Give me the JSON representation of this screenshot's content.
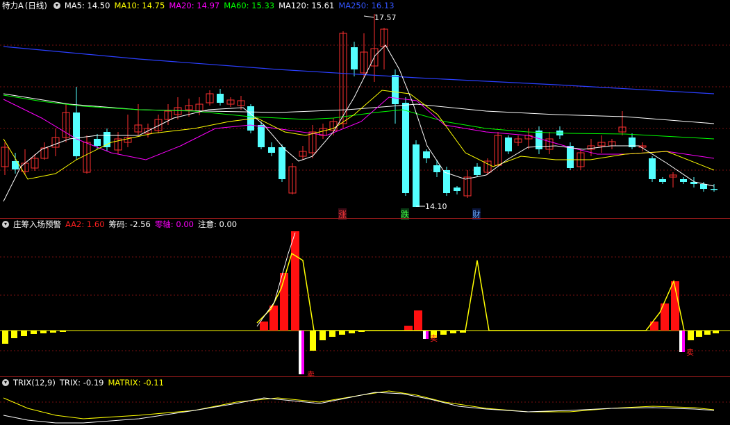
{
  "main_panel": {
    "stock_name": "特力A",
    "period": "(日线)",
    "ma": [
      {
        "label": "MA5:",
        "value": "14.50",
        "color": "#ffffff"
      },
      {
        "label": "MA10:",
        "value": "14.75",
        "color": "#ffff00"
      },
      {
        "label": "MA20:",
        "value": "14.97",
        "color": "#ff00ff"
      },
      {
        "label": "MA60:",
        "value": "15.33",
        "color": "#00ff00"
      },
      {
        "label": "MA120:",
        "value": "15.61",
        "color": "#ffffff"
      },
      {
        "label": "MA250:",
        "value": "16.13",
        "color": "#3355ff"
      }
    ],
    "high_marker": "17.57",
    "low_marker": "14.10",
    "tags": [
      {
        "text": "涨",
        "color": "#ff3b3b"
      },
      {
        "text": "跌",
        "color": "#44ff44"
      },
      {
        "text": "财",
        "color": "#66aaff"
      }
    ]
  },
  "indicator_panel": {
    "name": "庄筹入场预警",
    "values": [
      {
        "label": "AA2:",
        "value": "1.60",
        "color": "#ff2020"
      },
      {
        "label": "筹码:",
        "value": "-2.56",
        "color": "#ffffff"
      },
      {
        "label": "零轴:",
        "value": "0.00",
        "color": "#ff00ff"
      },
      {
        "label": "注意:",
        "value": "0.00",
        "color": "#ffffff"
      }
    ],
    "sell_label": "卖"
  },
  "trix_panel": {
    "name": "TRIX(12,9)",
    "values": [
      {
        "label": "TRIX:",
        "value": "-0.19",
        "color": "#ffffff"
      },
      {
        "label": "MATRIX:",
        "value": "-0.11",
        "color": "#ffff00"
      }
    ]
  },
  "colors": {
    "up": "#ff3030",
    "down": "#54ffff",
    "ma5": "#ffffff",
    "ma10": "#ffff00",
    "ma20": "#ff00ff",
    "ma60": "#00ff00",
    "ma120": "#ffffff",
    "ma250": "#2b3fff",
    "grid": "#7a1010"
  }
}
